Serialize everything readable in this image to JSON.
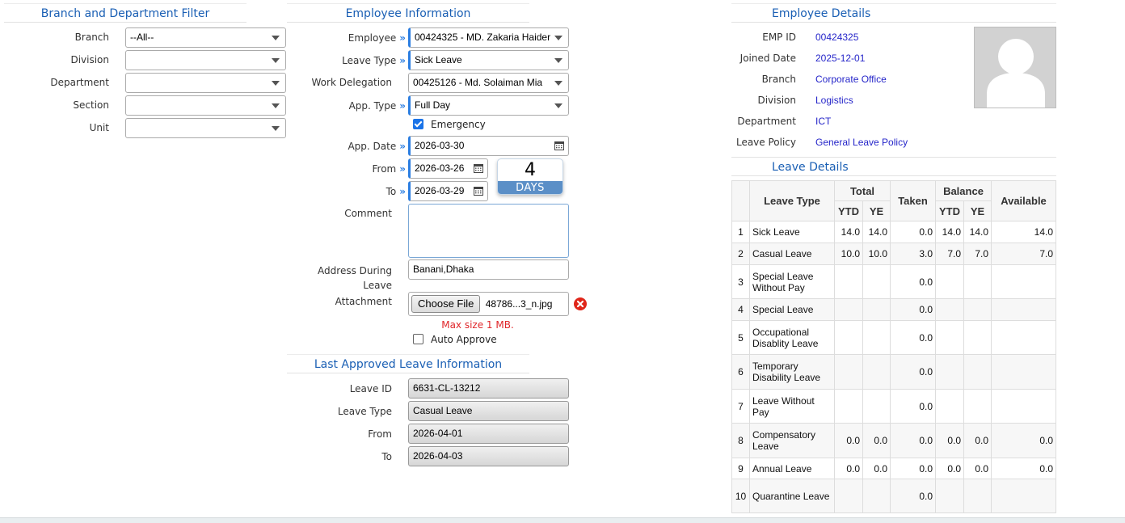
{
  "branch_filter": {
    "title": "Branch and Department Filter",
    "fields": [
      {
        "label": "Branch",
        "value": "--All--"
      },
      {
        "label": "Division",
        "value": ""
      },
      {
        "label": "Department",
        "value": ""
      },
      {
        "label": "Section",
        "value": ""
      },
      {
        "label": "Unit",
        "value": ""
      }
    ]
  },
  "employee_info": {
    "title": "Employee Information",
    "employee": {
      "label": "Employee",
      "value": "00424325 - MD. Zakaria Haider"
    },
    "leave_type": {
      "label": "Leave Type",
      "value": "Sick Leave"
    },
    "work_delegation": {
      "label": "Work Delegation",
      "value": "00425126 - Md. Solaiman Mia"
    },
    "app_type": {
      "label": "App. Type",
      "value": "Full Day"
    },
    "emergency": {
      "label": "Emergency",
      "checked": true
    },
    "app_date": {
      "label": "App. Date",
      "value": "2026-03-30"
    },
    "from": {
      "label": "From",
      "value": "2026-03-26"
    },
    "to": {
      "label": "To",
      "value": "2026-03-29"
    },
    "days": {
      "count": "4",
      "label": "DAYS"
    },
    "comment": {
      "label": "Comment",
      "value": ""
    },
    "address": {
      "label_line1": "Address During",
      "label_line2": "Leave",
      "value": "Banani,Dhaka"
    },
    "attachment": {
      "label": "Attachment",
      "button": "Choose File",
      "filename": "48786...3_n.jpg",
      "max_size": "Max size 1 MB."
    },
    "auto_approve": {
      "label": "Auto Approve",
      "checked": false
    }
  },
  "last_approved": {
    "title": "Last Approved Leave Information",
    "leave_id": {
      "label": "Leave ID",
      "value": "6631-CL-13212"
    },
    "leave_type": {
      "label": "Leave Type",
      "value": "Casual Leave"
    },
    "from": {
      "label": "From",
      "value": "2026-04-01"
    },
    "to": {
      "label": "To",
      "value": "2026-04-03"
    }
  },
  "employee_details": {
    "title": "Employee Details",
    "rows": [
      {
        "label": "EMP ID",
        "value": "00424325"
      },
      {
        "label": "Joined Date",
        "value": "2025-12-01"
      },
      {
        "label": "Branch",
        "value": "Corporate Office"
      },
      {
        "label": "Division",
        "value": "Logistics"
      },
      {
        "label": "Department",
        "value": "ICT"
      },
      {
        "label": "Leave Policy",
        "value": "General Leave Policy"
      }
    ]
  },
  "leave_details": {
    "title": "Leave Details",
    "headers": {
      "leave_type": "Leave Type",
      "total": "Total",
      "taken": "Taken",
      "balance": "Balance",
      "available": "Available",
      "ytd": "YTD",
      "ye": "YE"
    },
    "rows": [
      {
        "idx": "1",
        "type": "Sick Leave",
        "total_ytd": "14.0",
        "total_ye": "14.0",
        "taken": "0.0",
        "bal_ytd": "14.0",
        "bal_ye": "14.0",
        "available": "14.0"
      },
      {
        "idx": "2",
        "type": "Casual Leave",
        "total_ytd": "10.0",
        "total_ye": "10.0",
        "taken": "3.0",
        "bal_ytd": "7.0",
        "bal_ye": "7.0",
        "available": "7.0"
      },
      {
        "idx": "3",
        "type": "Special Leave Without Pay",
        "total_ytd": "",
        "total_ye": "",
        "taken": "0.0",
        "bal_ytd": "",
        "bal_ye": "",
        "available": ""
      },
      {
        "idx": "4",
        "type": "Special Leave",
        "total_ytd": "",
        "total_ye": "",
        "taken": "0.0",
        "bal_ytd": "",
        "bal_ye": "",
        "available": ""
      },
      {
        "idx": "5",
        "type": "Occupational Disablity Leave",
        "total_ytd": "",
        "total_ye": "",
        "taken": "0.0",
        "bal_ytd": "",
        "bal_ye": "",
        "available": ""
      },
      {
        "idx": "6",
        "type": "Temporary Disability Leave",
        "total_ytd": "",
        "total_ye": "",
        "taken": "0.0",
        "bal_ytd": "",
        "bal_ye": "",
        "available": ""
      },
      {
        "idx": "7",
        "type": "Leave Without Pay",
        "total_ytd": "",
        "total_ye": "",
        "taken": "0.0",
        "bal_ytd": "",
        "bal_ye": "",
        "available": ""
      },
      {
        "idx": "8",
        "type": "Compensatory Leave",
        "total_ytd": "0.0",
        "total_ye": "0.0",
        "taken": "0.0",
        "bal_ytd": "0.0",
        "bal_ye": "0.0",
        "available": "0.0"
      },
      {
        "idx": "9",
        "type": "Annual Leave",
        "total_ytd": "0.0",
        "total_ye": "0.0",
        "taken": "0.0",
        "bal_ytd": "0.0",
        "bal_ye": "0.0",
        "available": "0.0"
      },
      {
        "idx": "10",
        "type": "Quarantine Leave",
        "total_ytd": "",
        "total_ye": "",
        "taken": "0.0",
        "bal_ytd": "",
        "bal_ye": "",
        "available": ""
      }
    ]
  }
}
